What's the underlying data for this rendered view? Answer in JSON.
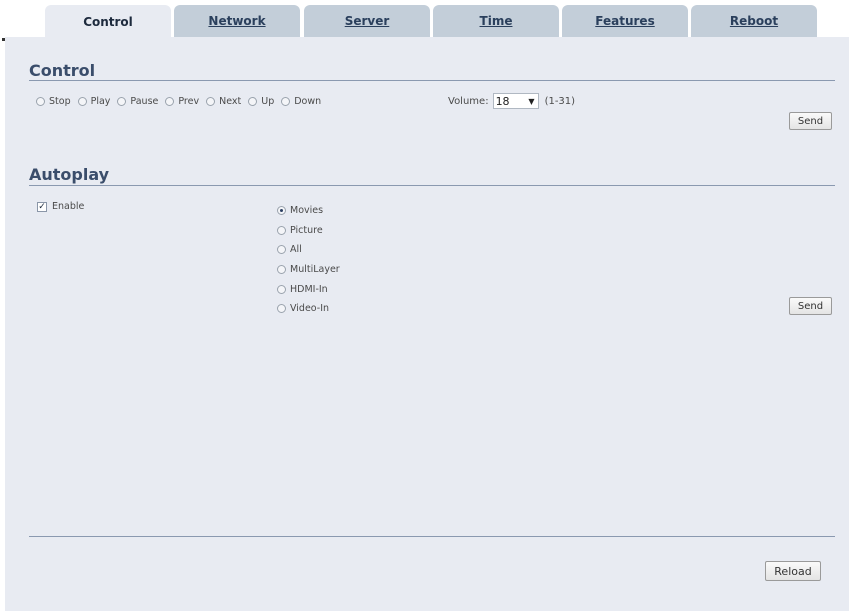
{
  "tabs": [
    {
      "label": "Control",
      "active": true
    },
    {
      "label": "Network",
      "active": false
    },
    {
      "label": "Server",
      "active": false
    },
    {
      "label": "Time",
      "active": false
    },
    {
      "label": "Features",
      "active": false
    },
    {
      "label": "Reboot",
      "active": false
    }
  ],
  "control": {
    "title": "Control",
    "options": [
      "Stop",
      "Play",
      "Pause",
      "Prev",
      "Next",
      "Up",
      "Down"
    ],
    "volume_label": "Volume:",
    "volume_value": "18",
    "volume_range": "(1-31)",
    "send_label": "Send"
  },
  "autoplay": {
    "title": "Autoplay",
    "enable_label": "Enable",
    "enable_checked": true,
    "options": [
      "Movies",
      "Picture",
      "All",
      "MultiLayer",
      "HDMI-In",
      "Video-In"
    ],
    "selected": "Movies",
    "send_label": "Send"
  },
  "footer": {
    "reload_label": "Reload"
  },
  "colors": {
    "panel_bg": "#e8ebf2",
    "tab_inactive": "#c3ced9",
    "heading": "#3a4d6b"
  }
}
